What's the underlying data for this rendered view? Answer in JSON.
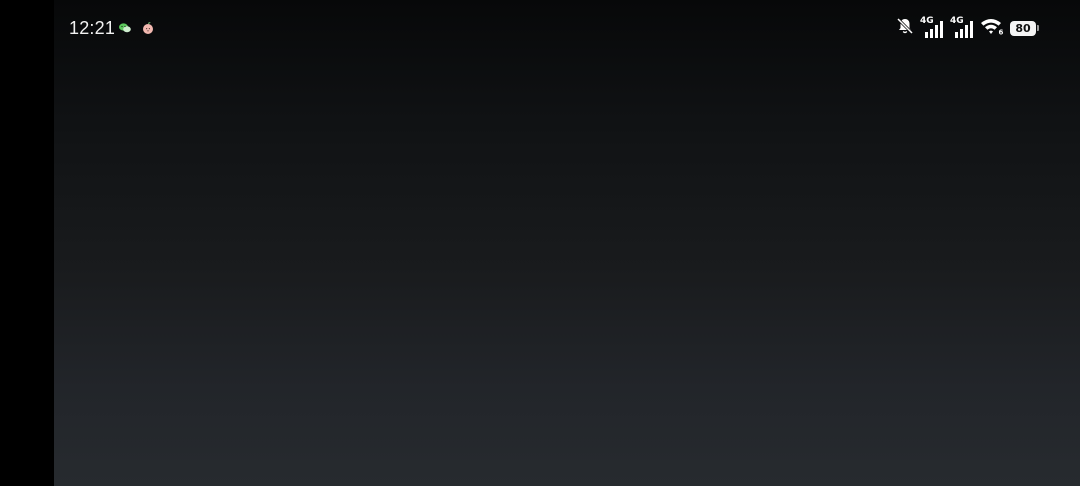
{
  "status_bar": {
    "time": "12:21",
    "notification_icons": [
      "wechat-icon",
      "peach-app-icon"
    ],
    "network_1": "4G",
    "network_2": "4G",
    "wifi_badge": "6",
    "battery_level": "80"
  },
  "colors": {
    "background_top": "#070809",
    "background_bottom": "#272b2f",
    "wechat_green": "#5cc95c",
    "peach": "#f2b8b0"
  }
}
